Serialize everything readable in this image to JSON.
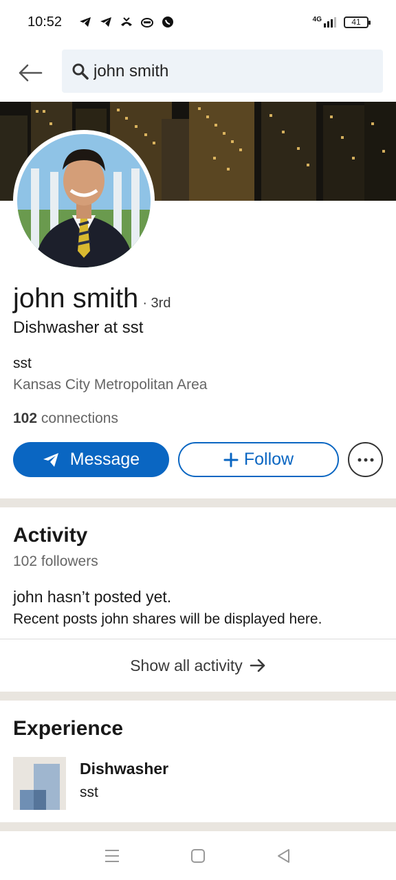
{
  "status_bar": {
    "time": "10:52",
    "network": "4G",
    "battery": "41",
    "icons": [
      "telegram-icon",
      "telegram-icon",
      "missed-call-icon",
      "incognito-icon",
      "whatsapp-icon",
      "signal-icon",
      "battery-icon"
    ]
  },
  "search": {
    "query": "john smith",
    "back_icon": "arrow-left-icon",
    "search_icon": "search-icon"
  },
  "profile": {
    "name": "john smith",
    "degree": "· 3rd",
    "headline": "Dishwasher at sst",
    "company": "sst",
    "location": "Kansas City Metropolitan Area",
    "connections_count": "102",
    "connections_label": "connections"
  },
  "actions": {
    "message_label": "Message",
    "follow_label": "Follow",
    "more_icon": "more-horizontal-icon"
  },
  "activity": {
    "title": "Activity",
    "followers": "102 followers",
    "empty_title": "john hasn’t posted yet.",
    "empty_subtitle": "Recent posts john shares will be displayed here.",
    "show_all": "Show all activity"
  },
  "experience": {
    "title": "Experience",
    "items": [
      {
        "role": "Dishwasher",
        "company": "sst"
      }
    ]
  },
  "nav": {
    "icons": [
      "menu-icon",
      "home-square-icon",
      "back-triangle-icon"
    ]
  },
  "colors": {
    "primary": "#0a66c2",
    "divider": "#e9e5df",
    "search_bg": "#eef3f8",
    "muted_text": "#666666"
  }
}
